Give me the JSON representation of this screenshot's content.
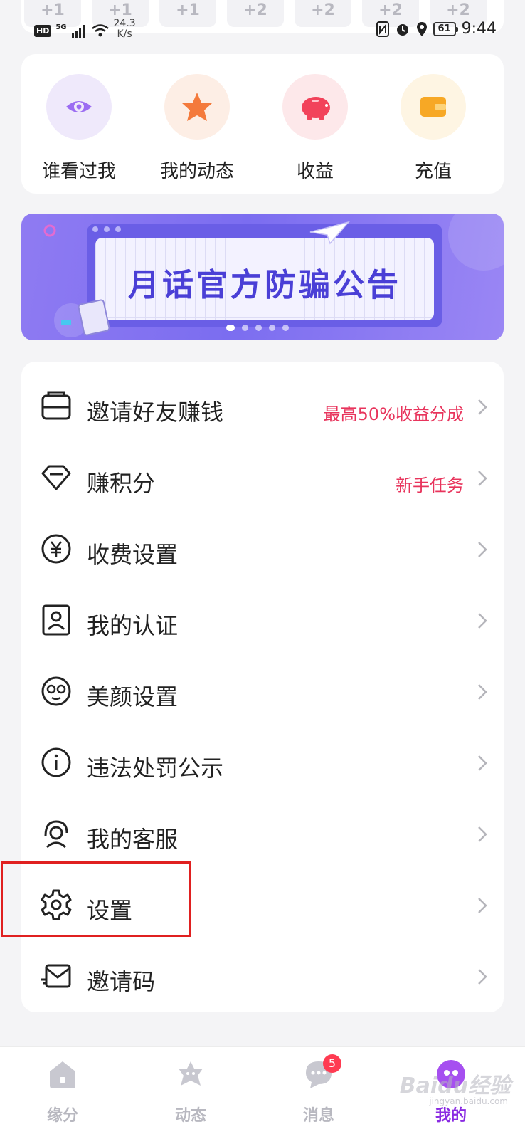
{
  "checkin": {
    "values": [
      "+1",
      "+1",
      "+1",
      "+2",
      "+2",
      "+2",
      "+2"
    ]
  },
  "status_bar": {
    "hd": "HD",
    "network": "5G",
    "speed": "24.3\nK/s",
    "battery": "61",
    "time": "9:44"
  },
  "quick_actions": [
    {
      "label": "谁看过我",
      "icon": "eye-icon",
      "color": "#9b6cf2"
    },
    {
      "label": "我的动态",
      "icon": "star-icon",
      "color": "#f47a3c"
    },
    {
      "label": "收益",
      "icon": "piggy-bank-icon",
      "color": "#f2425a"
    },
    {
      "label": "充值",
      "icon": "wallet-icon",
      "color": "#f7a825"
    }
  ],
  "banner": {
    "title": "月话官方防骗公告",
    "slides": 5,
    "active_slide": 0
  },
  "menu": [
    {
      "label": "邀请好友赚钱",
      "extra": "最高50%收益分成",
      "icon": "invite-box-icon"
    },
    {
      "label": "赚积分",
      "extra": "新手任务",
      "icon": "diamond-icon"
    },
    {
      "label": "收费设置",
      "extra": "",
      "icon": "yuan-circle-icon"
    },
    {
      "label": "我的认证",
      "extra": "",
      "icon": "id-card-icon"
    },
    {
      "label": "美颜设置",
      "extra": "",
      "icon": "face-icon"
    },
    {
      "label": "违法处罚公示",
      "extra": "",
      "icon": "info-circle-icon"
    },
    {
      "label": "我的客服",
      "extra": "",
      "icon": "headset-icon"
    },
    {
      "label": "设置",
      "extra": "",
      "icon": "gear-icon"
    },
    {
      "label": "邀请码",
      "extra": "",
      "icon": "mail-send-icon"
    }
  ],
  "bottom_nav": {
    "items": [
      {
        "label": "缘分",
        "icon": "home-icon"
      },
      {
        "label": "动态",
        "icon": "planet-icon"
      },
      {
        "label": "消息",
        "icon": "chat-icon",
        "badge": "5"
      },
      {
        "label": "我的",
        "icon": "profile-icon"
      }
    ],
    "active": "我的"
  },
  "watermark": {
    "text": "Baidu经验",
    "sub": "jingyan.baidu.com"
  },
  "colors": {
    "accent": "#8a2be2",
    "highlight_red": "#e8345c",
    "annotation": "#e02020"
  }
}
